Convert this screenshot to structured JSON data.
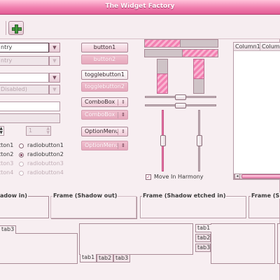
{
  "window": {
    "title": "The Widget Factory"
  },
  "toolbar": {
    "add_icon": "plus-icon"
  },
  "entries": {
    "entry1_value": "ntry",
    "entry2_value": "ntry",
    "entry3_value": "",
    "entry4_value": "Disabled)",
    "entry5_value": "",
    "entry6_value": "",
    "spin1_value": "",
    "spin2_value": "1"
  },
  "radios": {
    "left": [
      "tton1",
      "tton2",
      "tton3",
      "tton4"
    ],
    "right": [
      "radiobutton1",
      "radiobutton2",
      "radiobutton3",
      "radiobutton4"
    ],
    "selected": "radiobutton2"
  },
  "buttons": {
    "button1": "button1",
    "button2": "button2",
    "togglebutton1": "togglebutton1",
    "togglebutton2": "togglebutton2",
    "combo1": "ComboBox",
    "combo2": "ComboBox",
    "optionmenu1": "OptionMenu",
    "optionmenu2": "OptionMenu"
  },
  "controls": {
    "progress_h1": 0.5,
    "progress_h2": 0.5,
    "progress_v1": 0.6,
    "progress_v2": 0.6,
    "scale_h1": 0.5,
    "scale_h2": 0.5,
    "scale_v1": 0.5,
    "scale_v2": 0.5,
    "move_in_harmony_label": "Move In Harmony",
    "move_in_harmony_checked": true
  },
  "tree": {
    "columns": [
      "Column1",
      "Column"
    ]
  },
  "frames": {
    "frame1": "adow in)",
    "frame2": "Frame (Shadow out)",
    "frame3": "Frame (Shadow etched in)",
    "frame4": "Frame (S"
  },
  "notebooks": {
    "nb1_tabs": [
      "tab3"
    ],
    "nb2_tabs": [
      "tab1",
      "tab2",
      "tab3"
    ],
    "nb3_tabs": [
      "tab1",
      "tab2",
      "tab3"
    ]
  }
}
